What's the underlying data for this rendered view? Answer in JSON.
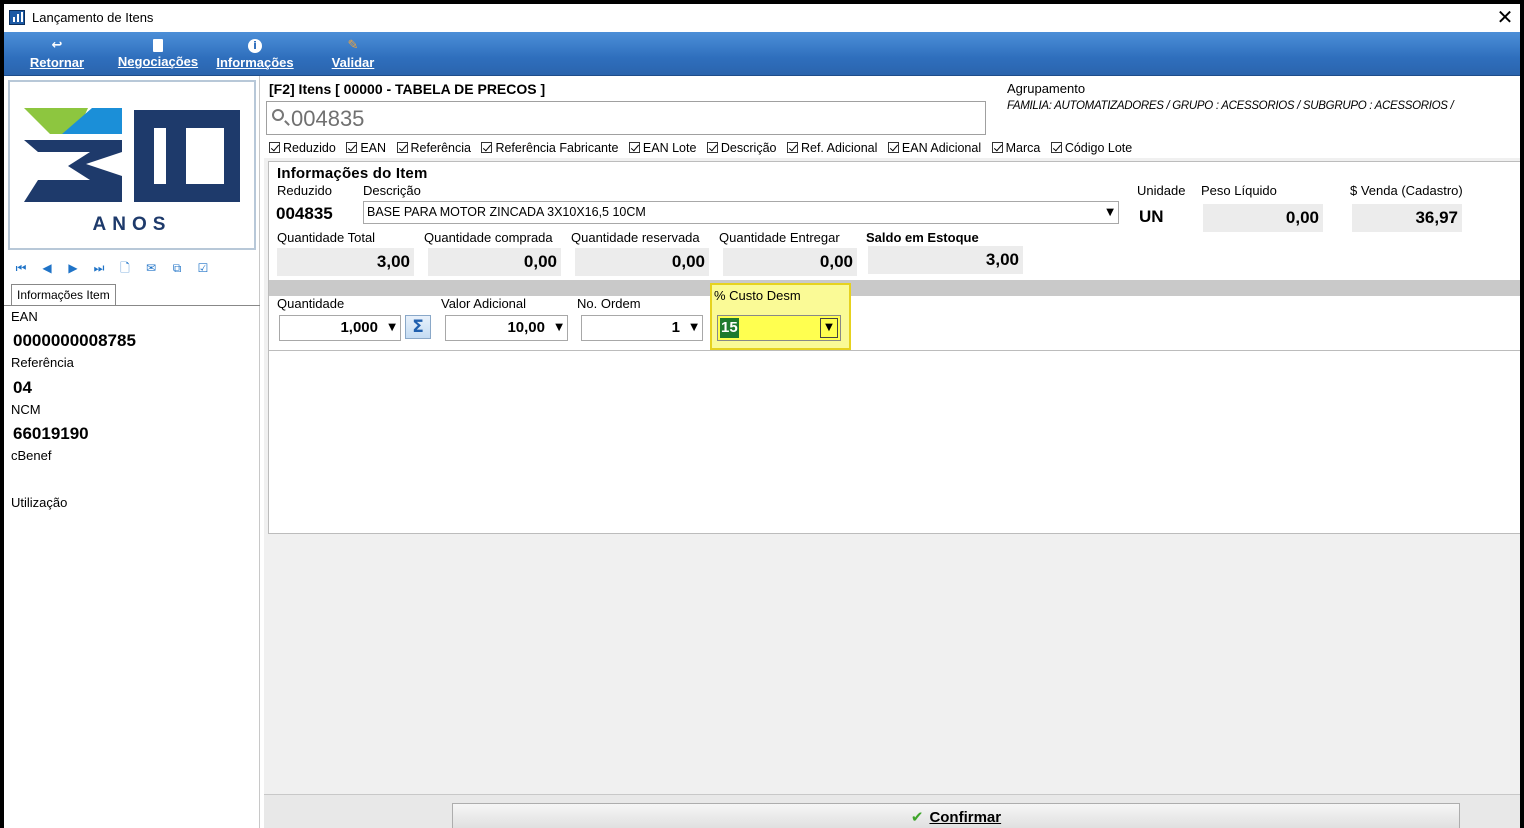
{
  "window": {
    "title": "Lançamento de Itens"
  },
  "toolbar": {
    "retornar": "Retornar",
    "negociacoes": "Negociações",
    "informacoes": "Informações",
    "validar": "Validar"
  },
  "left": {
    "logo_text": "ANOS",
    "tab_label": "Informações Item",
    "ean_label": "EAN",
    "ean_value": "0000000008785",
    "referencia_label": "Referência",
    "referencia_value": "04",
    "ncm_label": "NCM",
    "ncm_value": "66019190",
    "cbenef_label": "cBenef",
    "utilizacao_label": "Utilização"
  },
  "search": {
    "header": "[F2] Itens [ 00000 - TABELA DE PRECOS ]",
    "value": "004835",
    "agrupamento_label": "Agrupamento",
    "agrupamento_path": "FAMILIA: AUTOMATIZADORES / GRUPO : ACESSORIOS / SUBGRUPO : ACESSORIOS /"
  },
  "filters": [
    "Reduzido",
    "EAN",
    "Referência",
    "Referência Fabricante",
    "EAN Lote",
    "Descrição",
    "Ref. Adicional",
    "EAN Adicional",
    "Marca",
    "Código Lote"
  ],
  "item": {
    "group_title": "Informações do Item",
    "reduzido_label": "Reduzido",
    "reduzido_value": "004835",
    "descricao_label": "Descrição",
    "descricao_value": "BASE PARA MOTOR ZINCADA 3X10X16,5  10CM",
    "unidade_label": "Unidade",
    "unidade_value": "UN",
    "peso_label": "Peso Líquido",
    "peso_value": "0,00",
    "venda_label": "$ Venda (Cadastro)",
    "venda_value": "36,97",
    "qt_total_label": "Quantidade Total",
    "qt_total_value": "3,00",
    "qt_comprada_label": "Quantidade comprada",
    "qt_comprada_value": "0,00",
    "qt_reservada_label": "Quantidade reservada",
    "qt_reservada_value": "0,00",
    "qt_entregar_label": "Quantidade Entregar",
    "qt_entregar_value": "0,00",
    "saldo_label": "Saldo em Estoque",
    "saldo_value": "3,00"
  },
  "entry": {
    "quantidade_label": "Quantidade",
    "quantidade_value": "1,000",
    "valor_label": "Valor Adicional",
    "valor_value": "10,00",
    "ordem_label": "No. Ordem",
    "ordem_value": "1",
    "custo_label": "% Custo Desm",
    "custo_value": "15"
  },
  "confirm": {
    "label": "Confirmar"
  },
  "colors": {
    "toolbar": "#2f6fbd",
    "highlight": "#fafa96",
    "selection": "#1f7a2e",
    "logo_green": "#8dc63f",
    "logo_blue": "#1b8fd8",
    "logo_navy": "#1e3a6b"
  },
  "icons": [
    "app-icon",
    "close-icon",
    "return-icon",
    "document-icon",
    "info-icon",
    "validate-icon",
    "search-icon",
    "sum-icon",
    "check-icon"
  ]
}
